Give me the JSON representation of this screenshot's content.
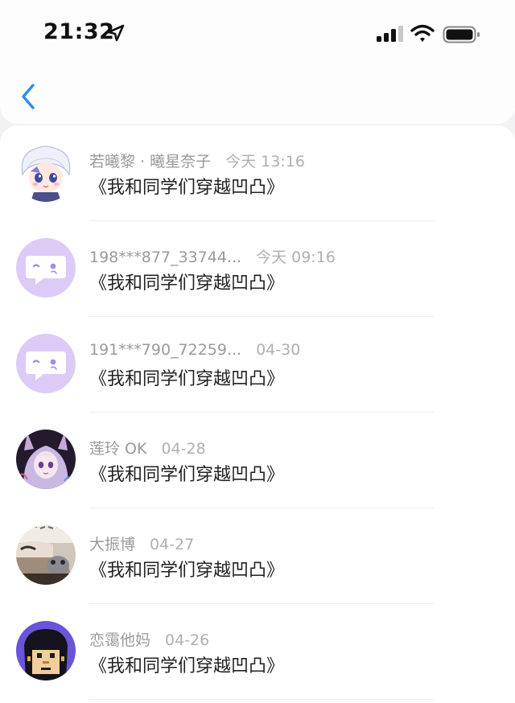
{
  "status_bar": {
    "time": "21:32"
  },
  "nav": {
    "back_icon": "chevron-left-icon",
    "accent_color": "#2e8fe6"
  },
  "items": [
    {
      "name": "若曦黎 · 曦星奈子",
      "time": "今天 13:16",
      "title": "《我和同学们穿越凹凸》",
      "avatar": "anime-boy-avatar"
    },
    {
      "name": "198***877_33744...",
      "time": "今天 09:16",
      "title": "《我和同学们穿越凹凸》",
      "avatar": "default-chat-avatar"
    },
    {
      "name": "191***790_72259...",
      "time": "04-30",
      "title": "《我和同学们穿越凹凸》",
      "avatar": "default-chat-avatar"
    },
    {
      "name": "莲玲 OK",
      "time": "04-28",
      "title": "《我和同学们穿越凹凸》",
      "avatar": "anime-girl-avatar"
    },
    {
      "name": "大振博",
      "time": "04-27",
      "title": "《我和同学们穿越凹凸》",
      "avatar": "photo-avatar"
    },
    {
      "name": "恋霭他妈",
      "time": "04-26",
      "title": "《我和同学们穿越凹凸》",
      "avatar": "pixel-face-avatar"
    }
  ],
  "colors": {
    "default_avatar_bg": "#dccbf7",
    "default_avatar_fg": "#a98be6"
  }
}
